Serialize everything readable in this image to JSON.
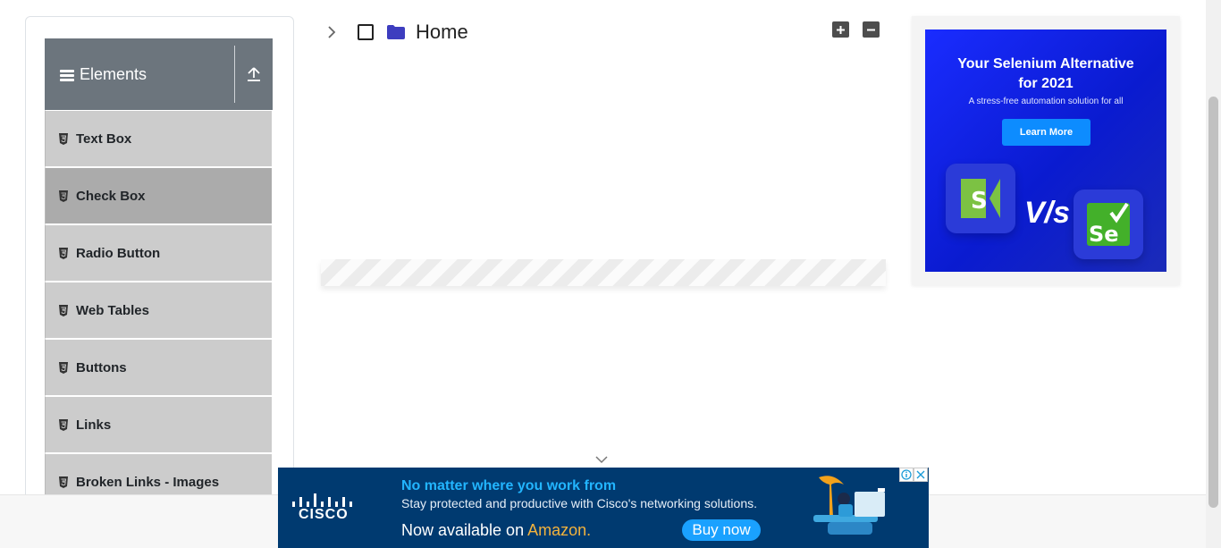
{
  "sidebar": {
    "group_title": "Elements",
    "items": [
      {
        "label": "Text Box"
      },
      {
        "label": "Check Box"
      },
      {
        "label": "Radio Button"
      },
      {
        "label": "Web Tables"
      },
      {
        "label": "Buttons"
      },
      {
        "label": "Links"
      },
      {
        "label": "Broken Links - Images"
      }
    ]
  },
  "tree": {
    "root_label": "Home",
    "expand_all_icon": "plus-square-icon",
    "collapse_all_icon": "minus-square-icon"
  },
  "side_ad": {
    "title_line1": "Your Selenium Alternative",
    "title_line2": "for 2021",
    "subtitle": "A stress-free automation solution for all",
    "button_label": "Learn More",
    "vs_text": "V/s",
    "right_tile_text": "Se",
    "left_tile_text": "S"
  },
  "bottom_ad": {
    "brand": "CISCO",
    "headline": "No matter where you work from",
    "body": "Stay protected and productive with Cisco's networking solutions.",
    "availability_prefix": "Now available on ",
    "availability_store": "Amazon.",
    "cta": "Buy now"
  },
  "colors": {
    "sidebar_header": "#6c757d",
    "menu_item": "#cccccc",
    "menu_item_active": "#ababab",
    "folder": "#3d3dbf",
    "bottom_ad_bg": "#003a70",
    "bottom_ad_headline": "#22b5ff",
    "amazon": "#f3b33d",
    "side_ad_bg": "#1a2cff"
  }
}
